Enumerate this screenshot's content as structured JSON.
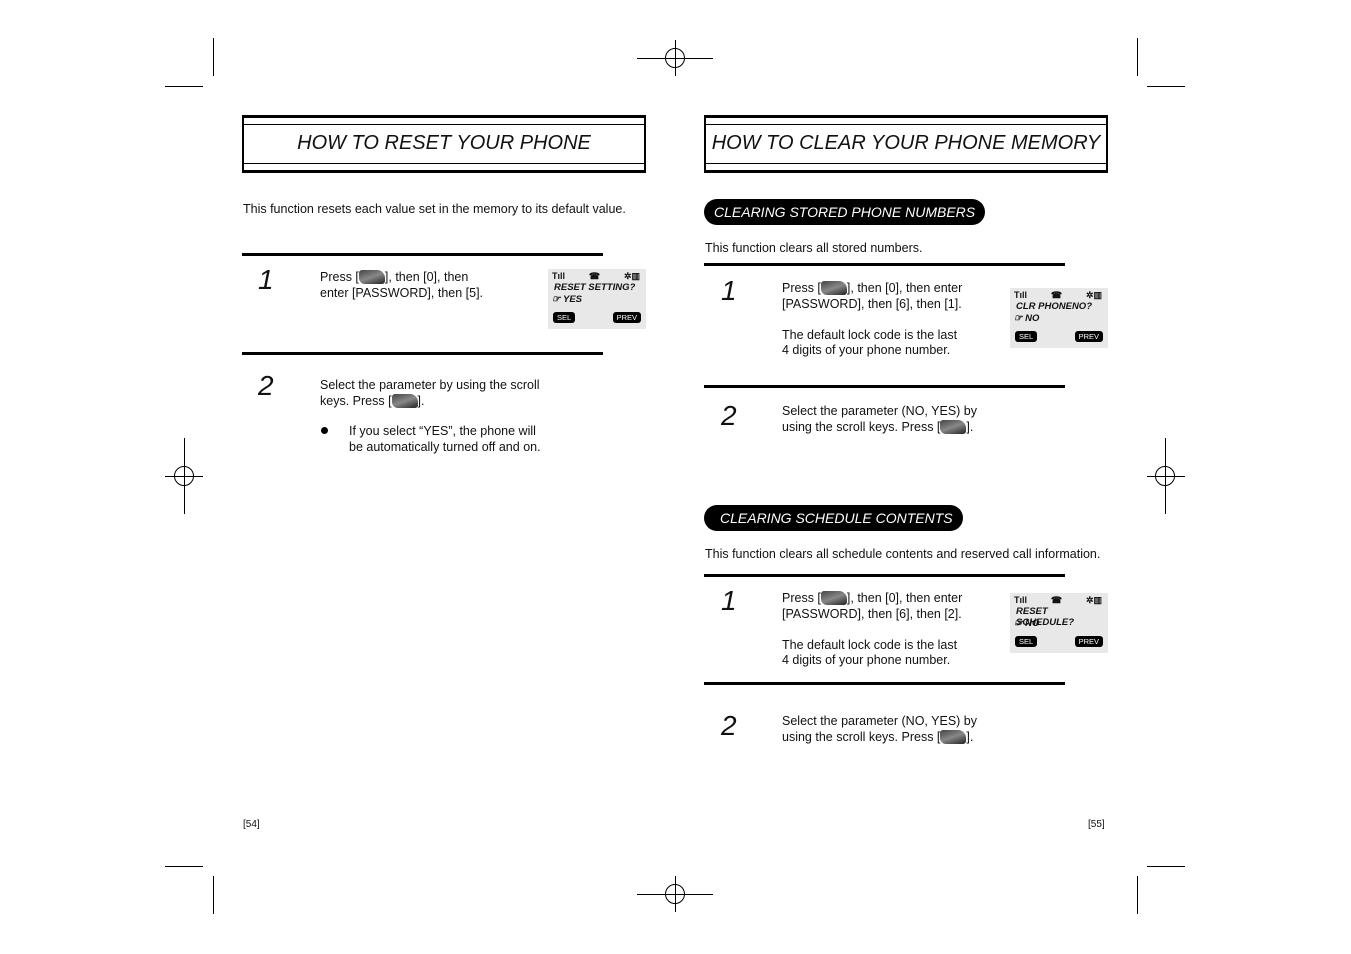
{
  "left": {
    "title": "HOW TO RESET YOUR PHONE",
    "intro": "This function resets each value set in the memory to its default value.",
    "steps": [
      {
        "number": "1",
        "line1": "Press [",
        "line1b": "], then [0], then",
        "line2": "enter [PASSWORD], then [5]."
      },
      {
        "number": "2",
        "line1": "Select the parameter by using the scroll",
        "line2": "keys.  Press [",
        "line2b": "].",
        "bullet1": "If you select “YES”, the phone will",
        "bullet2": "be automatically turned off and on."
      }
    ],
    "lcd": {
      "line1": "RESET SETTING?",
      "line2": "YES",
      "sel": "SEL",
      "prev": "PREV"
    },
    "page": "[54]"
  },
  "right": {
    "title": "HOW TO CLEAR YOUR PHONE MEMORY",
    "sections": [
      {
        "heading": "CLEARING STORED PHONE NUMBERS",
        "intro": "This function clears all stored numbers.",
        "step1": {
          "number": "1",
          "a": "Press [",
          "b": "], then [0], then enter",
          "c": "[PASSWORD], then [6], then [1].",
          "d": "The default lock code is the last",
          "e": "4 digits of your phone number."
        },
        "step2": {
          "number": "2",
          "a": "Select the parameter (NO, YES) by",
          "b": "using the scroll keys.  Press [",
          "c": "]."
        },
        "lcd": {
          "line1": "CLR PHONENO?",
          "line2": "NO",
          "sel": "SEL",
          "prev": "PREV"
        }
      },
      {
        "heading": "CLEARING SCHEDULE CONTENTS",
        "intro": "This function clears all schedule contents and reserved call information.",
        "step1": {
          "number": "1",
          "a": "Press [",
          "b": "], then [0], then enter",
          "c": "[PASSWORD], then [6], then [2].",
          "d": "The default lock code is the last",
          "e": "4 digits of your phone number."
        },
        "step2": {
          "number": "2",
          "a": "Select the parameter (NO, YES) by",
          "b": "using the scroll keys.  Press [",
          "c": "]."
        },
        "lcd": {
          "line1": "RESET SCHEDULE?",
          "line2": "NO",
          "sel": "SEL",
          "prev": "PREV"
        }
      }
    ],
    "page": "[55]"
  }
}
